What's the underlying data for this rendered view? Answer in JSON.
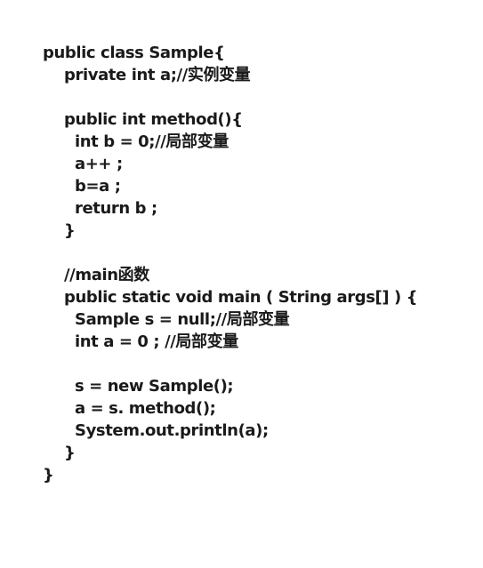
{
  "code": {
    "lines": [
      "public class Sample{",
      "private int a;//实例变量",
      "",
      "public int method(){",
      "int b = 0;//局部变量",
      "a++ ;",
      "b=a ;",
      "return b ;",
      "}",
      "",
      "//main函数",
      "public static void main ( String args[] ) {",
      "Sample s = null;//局部变量",
      "int a = 0 ; //局部变量",
      "",
      "s = new Sample();",
      "a = s. method();",
      "System.out.println(a);",
      "}",
      "}"
    ]
  }
}
